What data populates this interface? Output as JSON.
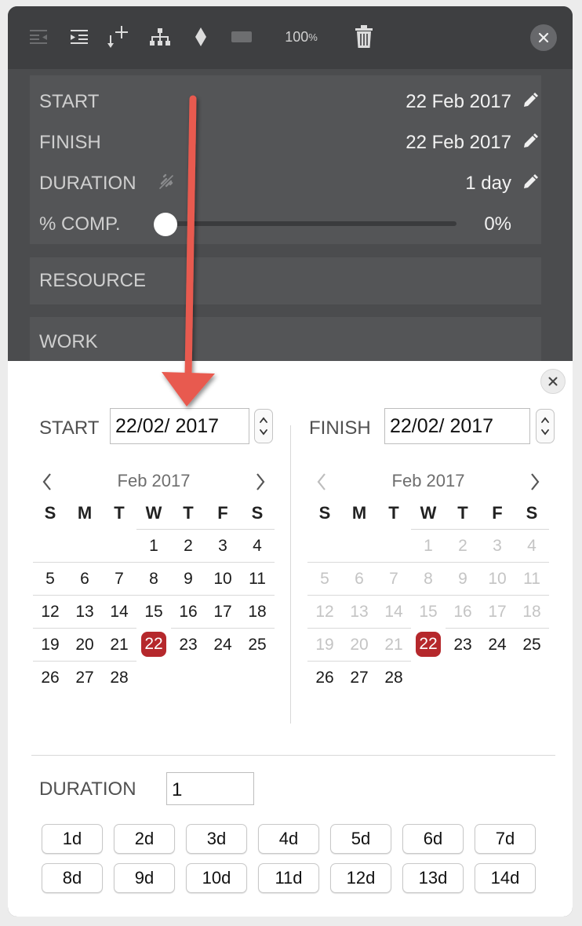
{
  "toolbar": {
    "zoom_value": "100",
    "zoom_unit": "%",
    "icons": [
      "outdent-icon",
      "indent-icon",
      "insert-task-icon",
      "hierarchy-icon",
      "milestone-icon",
      "task-bar-icon",
      "trash-icon",
      "close-icon"
    ]
  },
  "inspector": {
    "start_label": "START",
    "start_value": "22 Feb 2017",
    "finish_label": "FINISH",
    "finish_value": "22 Feb 2017",
    "duration_label": "DURATION",
    "duration_value": "1 day",
    "complete_label": "% COMP.",
    "complete_value": "0%",
    "complete_fraction": 0,
    "resource_label": "RESOURCE",
    "work_label": "WORK"
  },
  "popover": {
    "start_label": "START",
    "start_date": "22/02/ 2017",
    "finish_label": "FINISH",
    "finish_date": "22/02/ 2017",
    "duration_label": "DURATION",
    "duration_value": "1",
    "start_calendar": {
      "month": "Feb 2017",
      "weekdays": [
        "S",
        "M",
        "T",
        "W",
        "T",
        "F",
        "S"
      ],
      "selected": "22"
    },
    "finish_calendar": {
      "month": "Feb 2017",
      "weekdays": [
        "S",
        "M",
        "T",
        "W",
        "T",
        "F",
        "S"
      ],
      "selected": "22"
    },
    "duration_buttons": [
      "1d",
      "2d",
      "3d",
      "4d",
      "5d",
      "6d",
      "7d",
      "8d",
      "9d",
      "10d",
      "11d",
      "12d",
      "13d",
      "14d"
    ]
  },
  "colors": {
    "accent_selected": "#b5282c",
    "annotation_arrow": "#e85a4f"
  }
}
